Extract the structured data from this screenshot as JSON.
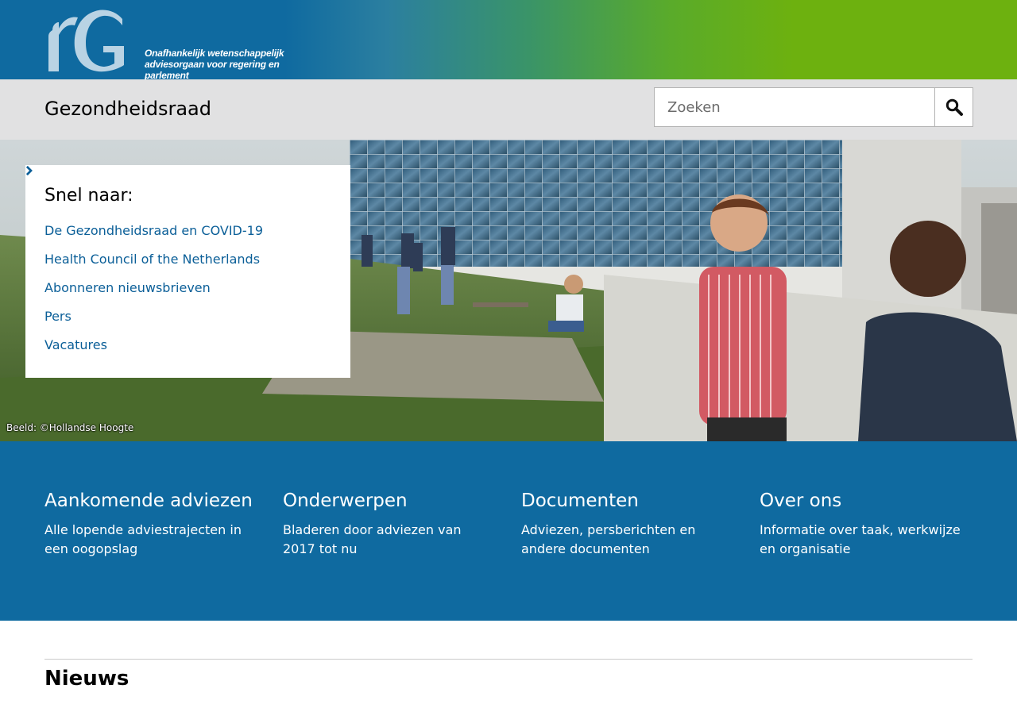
{
  "banner": {
    "logo_icon": "rg-monogram-logo",
    "tagline_line1": "Onafhankelijk wetenschappelijk",
    "tagline_line2": "adviesorgaan voor regering en parlement"
  },
  "header": {
    "site_title": "Gezondheidsraad",
    "search": {
      "placeholder": "Zoeken",
      "value": "",
      "button_icon": "search-icon"
    }
  },
  "hero": {
    "photo_credit": "Beeld: ©Hollandse Hoogte",
    "quicklinks": {
      "title": "Snel naar:",
      "items": [
        {
          "label": "De Gezondheidsraad en COVID-19",
          "icon": "chevron-right-icon"
        },
        {
          "label": "Health Council of the Netherlands",
          "icon": "chevron-right-icon"
        },
        {
          "label": "Abonneren nieuwsbrieven",
          "icon": "chevron-right-icon"
        },
        {
          "label": "Pers",
          "icon": "chevron-right-icon"
        },
        {
          "label": "Vacatures",
          "icon": "chevron-right-icon"
        }
      ]
    }
  },
  "tiles": [
    {
      "title": "Aankomende adviezen",
      "description": "Alle lopende adviestrajecten in een oogopslag"
    },
    {
      "title": "Onderwerpen",
      "description": "Bladeren door adviezen van 2017 tot nu"
    },
    {
      "title": "Documenten",
      "description": "Adviezen, persberichten en andere documenten"
    },
    {
      "title": "Over ons",
      "description": "Informatie over taak, werkwijze en organisatie"
    }
  ],
  "news": {
    "title": "Nieuws"
  },
  "colors": {
    "brand_blue": "#0f6aa0",
    "brand_green": "#6db10f",
    "link_blue": "#0b5f98",
    "header_grey": "#e1e1e2"
  }
}
